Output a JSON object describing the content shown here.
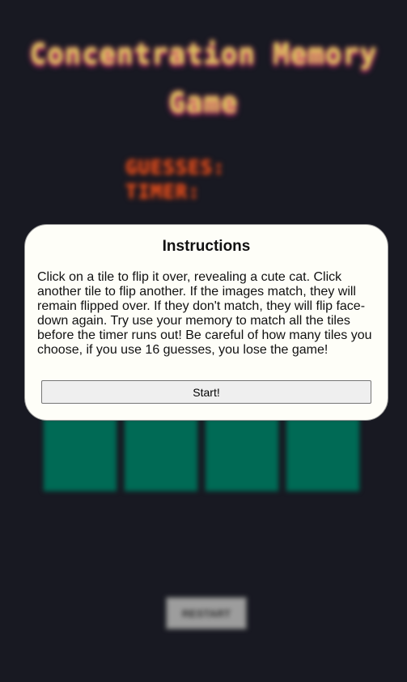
{
  "game": {
    "title": "Concentration Memory Game",
    "stats": {
      "guesses_label": "GUESSES:",
      "timer_label": "TIMER:"
    },
    "restart_label": "RESTART",
    "tile_count": 12
  },
  "modal": {
    "title": "Instructions",
    "body": "Click on a tile to flip it over, revealing a cute cat. Click another tile to flip another. If the images match, they will remain flipped over. If they don't match, they will flip face-down again. Try use your memory to match all the tiles before the timer runs out! Be careful of how many tiles you choose, if you use 16 guesses, you lose the game!",
    "start_label": "Start!"
  },
  "colors": {
    "background": "#181922",
    "tile": "#006a55",
    "title": "#d8cf5a",
    "stats": "#e0531e",
    "modal": "#fefef8"
  }
}
